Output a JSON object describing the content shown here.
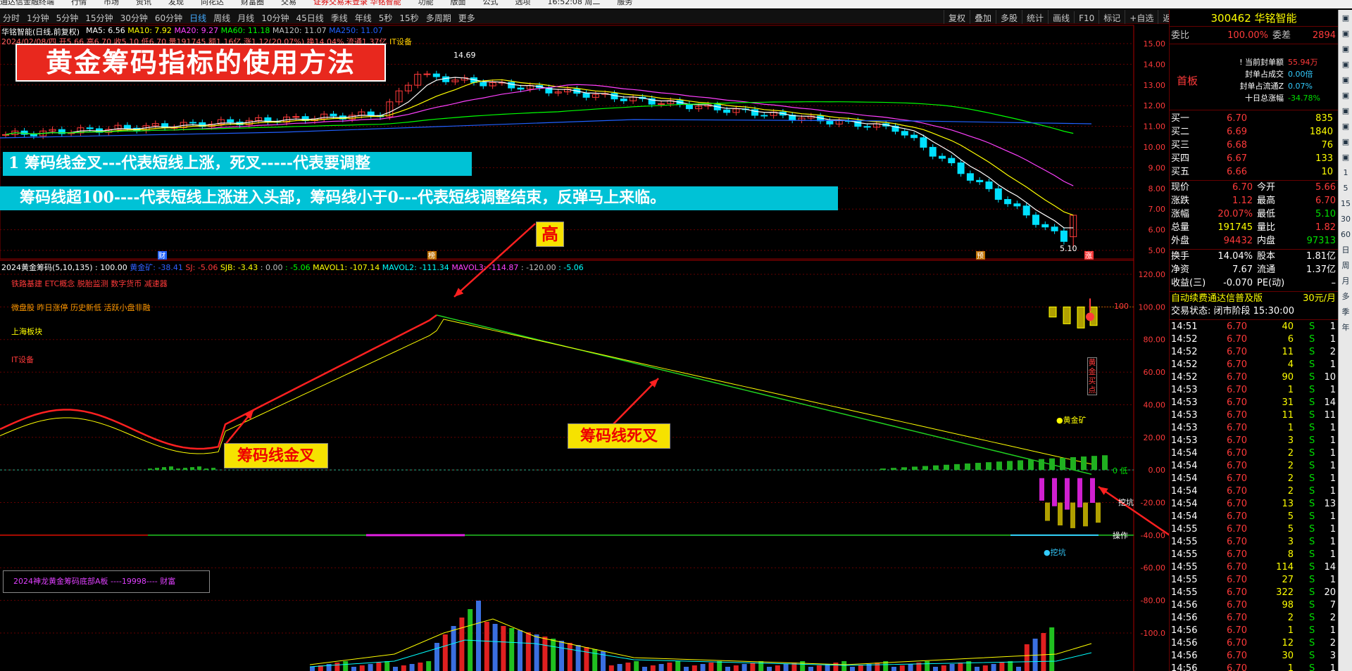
{
  "menubar": [
    "通达信金融终端",
    "行情",
    "市场",
    "资讯",
    "发现",
    "同花达",
    "财富圈",
    "交易",
    "证券交易未登录  华铭智能",
    "功能",
    "版面",
    "公式",
    "选项",
    "16:52:08 周二",
    "服务"
  ],
  "periods": [
    "分时",
    "1分钟",
    "5分钟",
    "15分钟",
    "30分钟",
    "60分钟",
    "日线",
    "周线",
    "月线",
    "10分钟",
    "45日线",
    "季线",
    "年线",
    "5秒",
    "15秒",
    "多周期",
    "更多"
  ],
  "active_period": "日线",
  "toolbar_buttons": [
    "复权",
    "叠加",
    "多股",
    "统计",
    "画线",
    "F10",
    "标记",
    "+自选",
    "返回"
  ],
  "stock": {
    "title": "华铭智能(日线,前复权)",
    "ma": [
      {
        "text": "MA5: 6.56",
        "color": "#ffffff"
      },
      {
        "text": "MA10: 7.92",
        "color": "#ffff00"
      },
      {
        "text": "MA20: 9.27",
        "color": "#ff40ff"
      },
      {
        "text": "MA60: 11.18",
        "color": "#00ff00"
      },
      {
        "text": "MA120: 11.07",
        "color": "#c0c0c0"
      },
      {
        "text": "MA250: 11.07",
        "color": "#2060ff"
      }
    ],
    "date_line": "2024/02/08/四 开5.66 高6.70 收5.10 低6.70 量191745 额1.16亿 涨1.12(20.07%) 换14.04% 流通1.37亿",
    "date_tag": "IT设备",
    "high_label": "14.69",
    "low_label": "5.10",
    "markers": {
      "cai": "财",
      "zhuo": "榜",
      "yu": "预",
      "zhang": "涨"
    }
  },
  "price_axis": [
    "15.00",
    "14.00",
    "13.00",
    "12.00",
    "11.00",
    "10.00",
    "9.00",
    "8.00",
    "7.00",
    "6.00",
    "5.00"
  ],
  "indicator": {
    "title": "2024黄金筹码(5,10,135) : 100.00",
    "values": [
      {
        "text": "黄金矿: -38.41",
        "color": "#3060ff"
      },
      {
        "text": "SJ: -5.06",
        "color": "#ff3a3a"
      },
      {
        "text": "SJB: -3.43",
        "color": "#ffff00"
      },
      {
        "text": ": 0.00",
        "color": "#c0c0c0"
      },
      {
        "text": ": -5.06",
        "color": "#00ff00"
      },
      {
        "text": "MAVOL1: -107.14",
        "color": "#ffff00"
      },
      {
        "text": "MAVOL2: -111.34",
        "color": "#00ffff"
      },
      {
        "text": "MAVOL3: -114.87",
        "color": "#ff40ff"
      },
      {
        "text": ": -120.00",
        "color": "#c0c0c0"
      },
      {
        "text": ": -5.06",
        "color": "#00ffff"
      }
    ],
    "concepts_red": "铁路基建 ETC概念 脱胎监测 数字货币 减速器",
    "concepts_orange": "微盘股 昨日涨停 历史新低 活跃小盘非融",
    "sector": "上海板块",
    "industry": "IT设备",
    "axis": [
      "120.00",
      "100.00",
      "80.00",
      "60.00",
      "40.00",
      "20.00",
      "0.00",
      "-20.00",
      "-40.00",
      "-60.00",
      "-80.00",
      "-100.0"
    ],
    "marker_100": "100",
    "marker_0": "0 低",
    "label_dig": "挖坑",
    "label_op": "操作",
    "label_gold": "●黄金矿",
    "label_dig2": "●挖坑",
    "buy_vertical": "黄金买点",
    "signature": "2024神龙黄金筹码底部A板    ----19998---- 财富"
  },
  "annotations": {
    "banner": "黄金筹码指标的使用方法",
    "line1": "1 筹码线金叉---代表短线上涨，死叉-----代表要调整",
    "line2": "筹码线超100----代表短线上涨进入头部，筹码线小于0---代表短线调整结束，反弹马上来临。",
    "high": "高",
    "golden_cross": "筹码线金叉",
    "dead_cross": "筹码线死叉",
    "low": "低"
  },
  "quote": {
    "code_name": "300462 华铭智能",
    "weibi_label": "委比",
    "weibi": "100.00%",
    "weicha_label": "委差",
    "weicha": "2894",
    "board": "首板",
    "seal_info": [
      {
        "label": "! 当前封单额",
        "value": "55.94万",
        "color": "#ff3a3a"
      },
      {
        "label": "封单占成交",
        "value": "0.00倍",
        "color": "#3cf"
      },
      {
        "label": "封单占流通Z",
        "value": "0.07%",
        "color": "#3cf"
      },
      {
        "label": "十日总涨幅",
        "value": "-34.78%",
        "color": "#00e000"
      }
    ],
    "bids": [
      {
        "label": "买一",
        "price": "6.70",
        "vol": "835"
      },
      {
        "label": "买二",
        "price": "6.69",
        "vol": "1840"
      },
      {
        "label": "买三",
        "price": "6.68",
        "vol": "76"
      },
      {
        "label": "买四",
        "price": "6.67",
        "vol": "133"
      },
      {
        "label": "买五",
        "price": "6.66",
        "vol": "10"
      }
    ],
    "stats": [
      {
        "l1": "现价",
        "v1": "6.70",
        "c1": "#ff3a3a",
        "l2": "今开",
        "v2": "5.66",
        "c2": "#ff3a3a"
      },
      {
        "l1": "涨跌",
        "v1": "1.12",
        "c1": "#ff3a3a",
        "l2": "最高",
        "v2": "6.70",
        "c2": "#ff3a3a"
      },
      {
        "l1": "涨幅",
        "v1": "20.07%",
        "c1": "#ff3a3a",
        "l2": "最低",
        "v2": "5.10",
        "c2": "#00e000"
      },
      {
        "l1": "总量",
        "v1": "191745",
        "c1": "#ffff00",
        "l2": "量比",
        "v2": "1.82",
        "c2": "#ff3a3a"
      },
      {
        "l1": "外盘",
        "v1": "94432",
        "c1": "#ff3a3a",
        "l2": "内盘",
        "v2": "97313",
        "c2": "#00e000"
      }
    ],
    "stats2": [
      {
        "l1": "换手",
        "v1": "14.04%",
        "l2": "股本",
        "v2": "1.81亿"
      },
      {
        "l1": "净资",
        "v1": "7.67",
        "l2": "流通",
        "v2": "1.37亿"
      },
      {
        "l1": "收益(三)",
        "v1": "-0.070",
        "l2": "PE(动)",
        "v2": "–"
      }
    ],
    "promo": "自动续费通达信普及版",
    "promo_price": "30元/月",
    "trade_state": "交易状态: 闭市阶段 15:30:00",
    "ticks": [
      [
        "14:51",
        "6.70",
        "40",
        "S",
        "1"
      ],
      [
        "14:52",
        "6.70",
        "6",
        "S",
        "1"
      ],
      [
        "14:52",
        "6.70",
        "11",
        "S",
        "2"
      ],
      [
        "14:52",
        "6.70",
        "4",
        "S",
        "1"
      ],
      [
        "14:52",
        "6.70",
        "90",
        "S",
        "10"
      ],
      [
        "14:53",
        "6.70",
        "1",
        "S",
        "1"
      ],
      [
        "14:53",
        "6.70",
        "31",
        "S",
        "14"
      ],
      [
        "14:53",
        "6.70",
        "11",
        "S",
        "11"
      ],
      [
        "14:53",
        "6.70",
        "1",
        "S",
        "1"
      ],
      [
        "14:53",
        "6.70",
        "3",
        "S",
        "1"
      ],
      [
        "14:54",
        "6.70",
        "2",
        "S",
        "1"
      ],
      [
        "14:54",
        "6.70",
        "2",
        "S",
        "1"
      ],
      [
        "14:54",
        "6.70",
        "2",
        "S",
        "1"
      ],
      [
        "14:54",
        "6.70",
        "2",
        "S",
        "1"
      ],
      [
        "14:54",
        "6.70",
        "13",
        "S",
        "13"
      ],
      [
        "14:54",
        "6.70",
        "5",
        "S",
        "1"
      ],
      [
        "14:55",
        "6.70",
        "5",
        "S",
        "1"
      ],
      [
        "14:55",
        "6.70",
        "3",
        "S",
        "1"
      ],
      [
        "14:55",
        "6.70",
        "8",
        "S",
        "1"
      ],
      [
        "14:55",
        "6.70",
        "114",
        "S",
        "14"
      ],
      [
        "14:55",
        "6.70",
        "27",
        "S",
        "1"
      ],
      [
        "14:55",
        "6.70",
        "322",
        "S",
        "20"
      ],
      [
        "14:56",
        "6.70",
        "98",
        "S",
        "7"
      ],
      [
        "14:56",
        "6.70",
        "2",
        "S",
        "2"
      ],
      [
        "14:56",
        "6.70",
        "1",
        "S",
        "1"
      ],
      [
        "14:56",
        "6.70",
        "12",
        "S",
        "2"
      ],
      [
        "14:56",
        "6.70",
        "30",
        "S",
        "3"
      ],
      [
        "14:56",
        "6.70",
        "1",
        "S",
        "1"
      ]
    ]
  },
  "sidebar_icons": [
    "arrow-up-icon",
    "arrow-down-icon",
    "app-icon",
    "chart-icon",
    "line-icon",
    "wave-icon",
    "rsi-icon",
    "mm-icon",
    "grid-icon",
    "pencil-icon",
    "1",
    "5",
    "15",
    "30",
    "60",
    "日",
    "周",
    "月",
    "多",
    "季",
    "年"
  ]
}
